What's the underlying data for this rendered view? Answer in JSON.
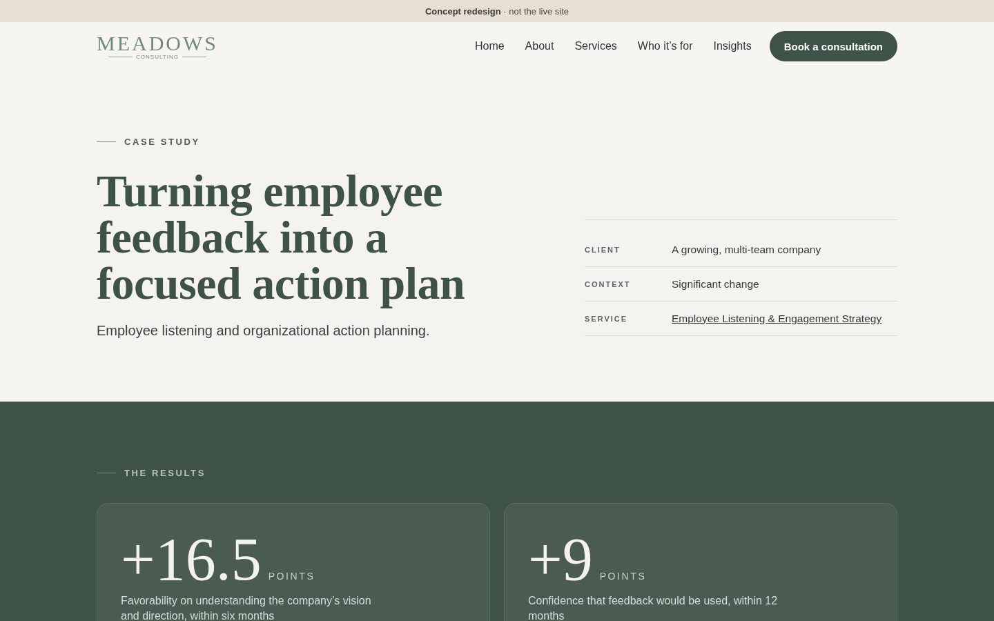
{
  "banner": {
    "strong": "Concept redesign",
    "rest": "· not the live site"
  },
  "logo": {
    "name": "MEADOWS",
    "tagline": "CONSULTING"
  },
  "nav": {
    "links": [
      "Home",
      "About",
      "Services",
      "Who it’s for",
      "Insights"
    ],
    "cta": "Book a consultation"
  },
  "hero": {
    "eyebrow": "CASE STUDY",
    "title": "Turning employee feedback into a focused action plan",
    "subtitle": "Employee listening and organizational action planning.",
    "facts": [
      {
        "label": "CLIENT",
        "value": "A growing, multi-team company",
        "kind": "text"
      },
      {
        "label": "CONTEXT",
        "value": "Significant change",
        "kind": "text"
      },
      {
        "label": "SERVICE",
        "value": "Employee Listening & Engagement Strategy",
        "kind": "link"
      }
    ]
  },
  "results": {
    "eyebrow": "THE RESULTS",
    "cards": [
      {
        "value": "+16.5",
        "unit": "POINTS",
        "description": "Favorability on understanding the company’s vision and direction, within six months"
      },
      {
        "value": "+9",
        "unit": "POINTS",
        "description": "Confidence that feedback would be used, within 12 months"
      }
    ]
  }
}
